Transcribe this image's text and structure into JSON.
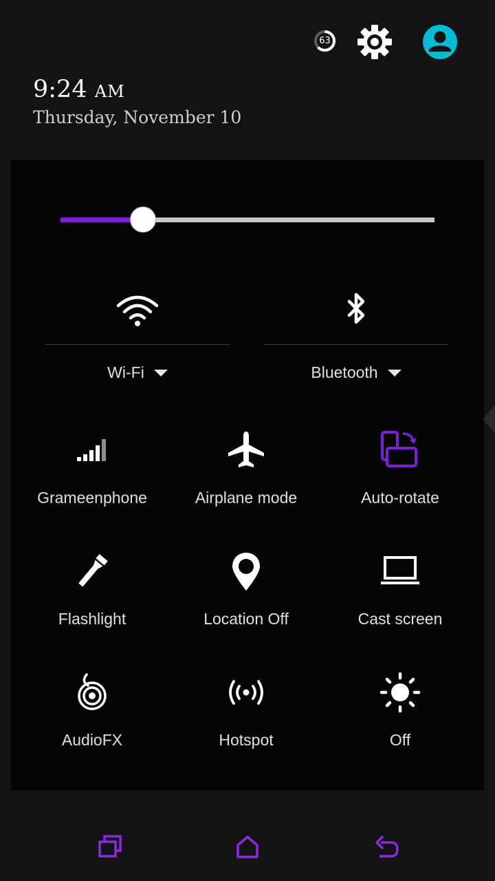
{
  "header": {
    "battery_level": "63",
    "time": "9:24",
    "ampm": "AM",
    "date": "Thursday, November 10"
  },
  "brightness": {
    "level": 0.22
  },
  "big_tiles": [
    {
      "label": "Wi-Fi",
      "icon": "wifi-icon"
    },
    {
      "label": "Bluetooth",
      "icon": "bluetooth-icon"
    }
  ],
  "tiles": [
    {
      "label": "Grameenphone",
      "icon": "signal-icon"
    },
    {
      "label": "Airplane mode",
      "icon": "airplane-icon"
    },
    {
      "label": "Auto-rotate",
      "icon": "auto-rotate-icon"
    },
    {
      "label": "Flashlight",
      "icon": "flashlight-icon"
    },
    {
      "label": "Location Off",
      "icon": "location-icon"
    },
    {
      "label": "Cast screen",
      "icon": "cast-screen-icon"
    },
    {
      "label": "AudioFX",
      "icon": "audiofx-icon"
    },
    {
      "label": "Hotspot",
      "icon": "hotspot-icon"
    },
    {
      "label": "Off",
      "icon": "brightness-icon"
    }
  ],
  "colors": {
    "accent": "#7b1fd9",
    "avatar": "#00bcd4",
    "nav": "#8a2be2"
  },
  "nav": {
    "recents_icon": "recents-icon",
    "home_icon": "home-icon",
    "back_icon": "back-icon"
  }
}
